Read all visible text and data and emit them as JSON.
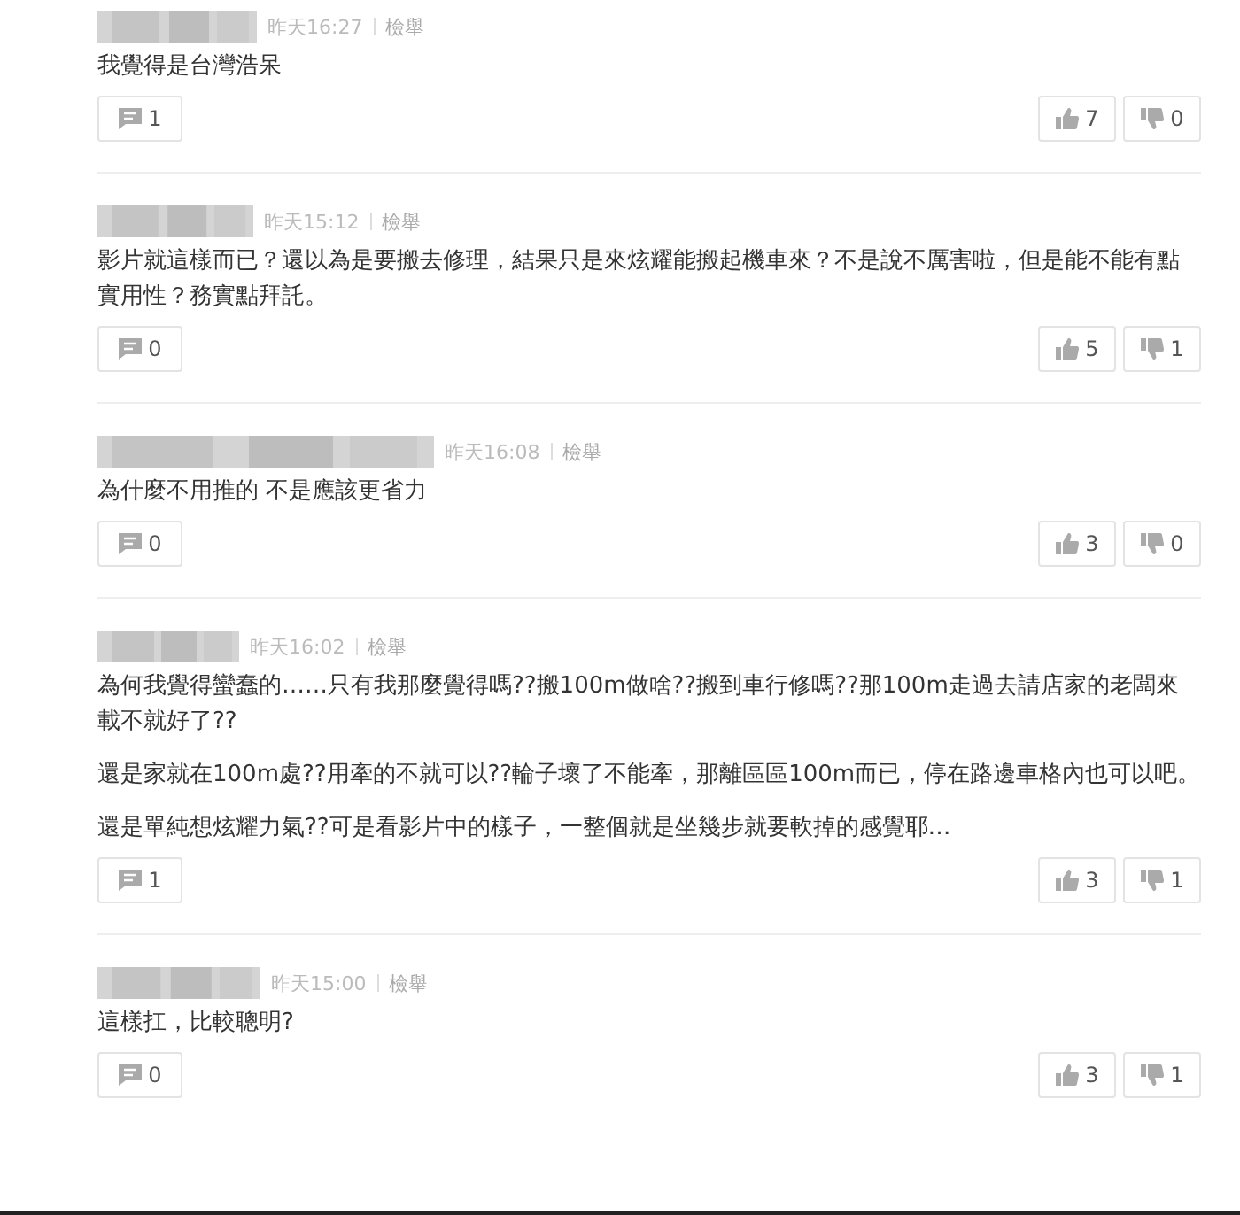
{
  "comments": [
    {
      "time": "昨天16:27",
      "report": "檢舉",
      "paragraphs": [
        "我覺得是台灣浩呆"
      ],
      "replies": "1",
      "likes": "7",
      "dislikes": "0"
    },
    {
      "time": "昨天15:12",
      "report": "檢舉",
      "paragraphs": [
        "影片就這樣而已？還以為是要搬去修理，結果只是來炫耀能搬起機車來？不是說不厲害啦，但是能不能有點實用性？務實點拜託。"
      ],
      "replies": "0",
      "likes": "5",
      "dislikes": "1"
    },
    {
      "time": "昨天16:08",
      "report": "檢舉",
      "paragraphs": [
        "為什麼不用推的 不是應該更省力"
      ],
      "replies": "0",
      "likes": "3",
      "dislikes": "0"
    },
    {
      "time": "昨天16:02",
      "report": "檢舉",
      "paragraphs": [
        "為何我覺得蠻蠢的……只有我那麼覺得嗎??搬100m做啥??搬到車行修嗎??那100m走過去請店家的老闆來載不就好了??",
        "還是家就在100m處??用牽的不就可以??輪子壞了不能牽，那離區區100m而已，停在路邊車格內也可以吧。",
        "還是單純想炫耀力氣??可是看影片中的樣子，一整個就是坐幾步就要軟掉的感覺耶…"
      ],
      "replies": "1",
      "likes": "3",
      "dislikes": "1"
    },
    {
      "time": "昨天15:00",
      "report": "檢舉",
      "paragraphs": [
        "這樣扛，比較聰明?"
      ],
      "replies": "0",
      "likes": "3",
      "dislikes": "1"
    }
  ]
}
